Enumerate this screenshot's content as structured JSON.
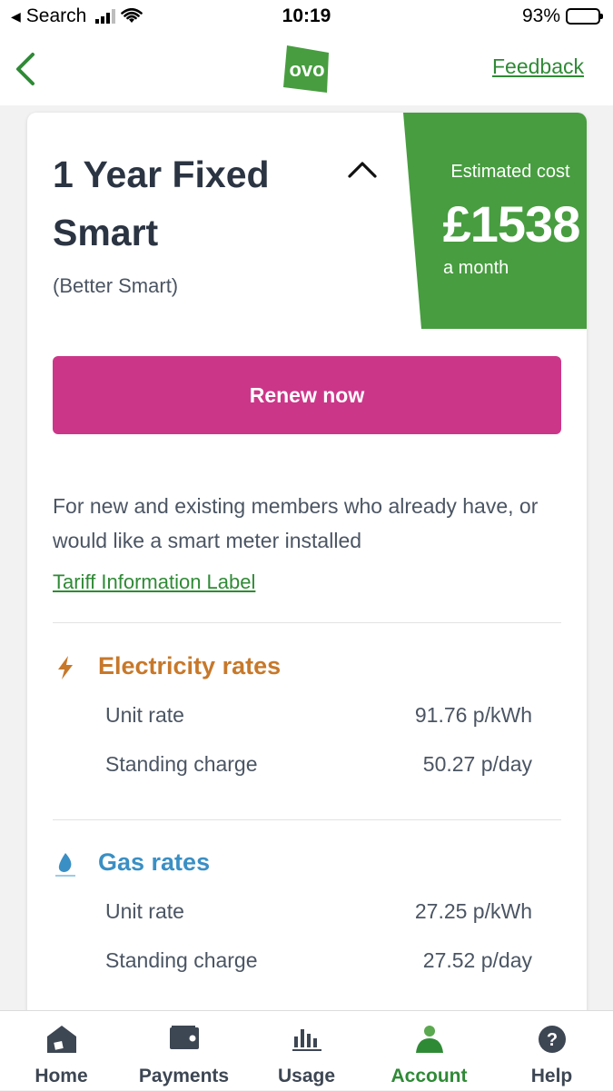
{
  "status_bar": {
    "back_app": "Search",
    "time": "10:19",
    "battery_pct": "93%"
  },
  "nav": {
    "feedback_label": "Feedback",
    "logo_text": "ovo"
  },
  "plan": {
    "title": "1 Year Fixed Smart",
    "subtitle": "(Better Smart)",
    "cost_label": "Estimated cost",
    "cost_value": "£1538",
    "cost_unit": "a month",
    "renew_label": "Renew now",
    "description": "For new and existing members who already have, or would like a smart meter installed",
    "tariff_link": "Tariff Information Label"
  },
  "electricity": {
    "title": "Electricity rates",
    "unit_rate_label": "Unit rate",
    "unit_rate_value": "91.76 p/kWh",
    "standing_label": "Standing charge",
    "standing_value": "50.27 p/day",
    "color": "#c7782a"
  },
  "gas": {
    "title": "Gas rates",
    "unit_rate_label": "Unit rate",
    "unit_rate_value": "27.25 p/kWh",
    "standing_label": "Standing charge",
    "standing_value": "27.52 p/day",
    "color": "#3a8fc4"
  },
  "tabs": [
    {
      "label": "Home",
      "icon": "home-icon"
    },
    {
      "label": "Payments",
      "icon": "wallet-icon"
    },
    {
      "label": "Usage",
      "icon": "bar-chart-icon"
    },
    {
      "label": "Account",
      "icon": "user-icon"
    },
    {
      "label": "Help",
      "icon": "help-icon"
    }
  ],
  "colors": {
    "brand_green": "#479d3f",
    "accent_pink": "#cc3689",
    "link_green": "#2f8a36"
  }
}
